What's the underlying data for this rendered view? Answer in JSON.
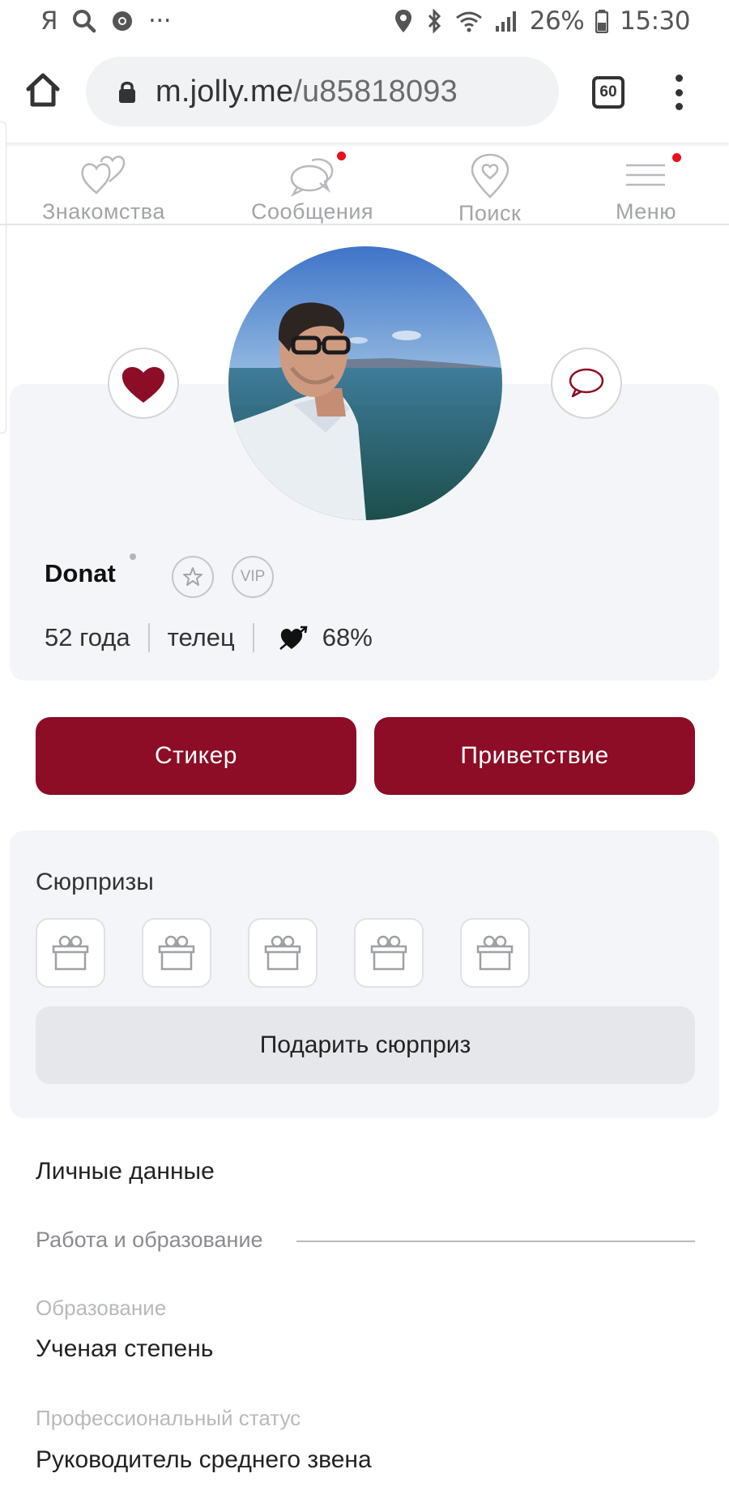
{
  "status_bar": {
    "left_text": "Я",
    "more": "···",
    "battery": "26%",
    "time": "15:30"
  },
  "browser": {
    "url_domain": "m.jolly.me",
    "url_path": "/u85818093",
    "tab_count": "60"
  },
  "nav": {
    "items": [
      {
        "label": "Знакомства",
        "icon": "hearts-icon",
        "badge": false
      },
      {
        "label": "Сообщения",
        "icon": "chat-bubbles-icon",
        "badge": true
      },
      {
        "label": "Поиск",
        "icon": "location-heart-icon",
        "badge": false
      },
      {
        "label": "Меню",
        "icon": "hamburger-icon",
        "badge": true
      }
    ]
  },
  "profile": {
    "name": "Donat",
    "vip_label": "VIP",
    "age": "52 года",
    "zodiac": "телец",
    "compatibility": "68%"
  },
  "actions": {
    "sticker_label": "Стикер",
    "greeting_label": "Приветствие"
  },
  "surprises": {
    "title": "Сюрпризы",
    "slot_count": 5,
    "gift_button_label": "Подарить сюрприз"
  },
  "details": {
    "section_title": "Личные данные",
    "work_section": "Работа и образование",
    "fields": [
      {
        "label": "Образование",
        "value": "Ученая степень"
      },
      {
        "label": "Профессиональный статус",
        "value": "Руководитель среднего звена"
      }
    ]
  },
  "colors": {
    "accent": "#8c0d25",
    "notification": "#e8111c",
    "card_bg": "#f4f5f9"
  }
}
